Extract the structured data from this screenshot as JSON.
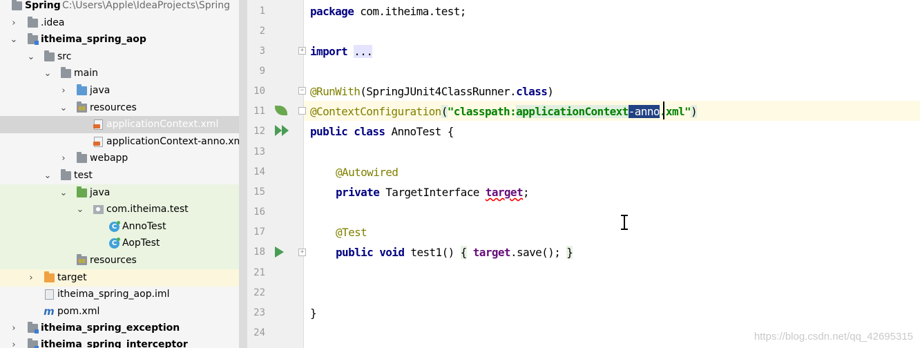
{
  "project": {
    "name": "Spring",
    "path": "C:\\Users\\Apple\\IdeaProjects\\Spring",
    "rows": [
      {
        "label": ".idea"
      },
      {
        "label": "itheima_spring_aop"
      },
      {
        "label": "src"
      },
      {
        "label": "main"
      },
      {
        "label": "java"
      },
      {
        "label": "resources"
      },
      {
        "label": "applicationContext.xml"
      },
      {
        "label": "applicationContext-anno.xml"
      },
      {
        "label": "webapp"
      },
      {
        "label": "test"
      },
      {
        "label": "java"
      },
      {
        "label": "com.itheima.test"
      },
      {
        "label": "AnnoTest"
      },
      {
        "label": "AopTest"
      },
      {
        "label": "resources"
      },
      {
        "label": "target"
      },
      {
        "label": "itheima_spring_aop.iml"
      },
      {
        "label": "pom.xml"
      },
      {
        "label": "itheima_spring_exception"
      },
      {
        "label": "itheima_spring_interceptor"
      }
    ]
  },
  "editor": {
    "line_numbers": [
      "1",
      "2",
      "3",
      "9",
      "10",
      "11",
      "12",
      "13",
      "14",
      "15",
      "16",
      "17",
      "18",
      "21",
      "22",
      "23",
      "24"
    ],
    "code": {
      "l1_kw": "package",
      "l1_rest": " com.itheima.test;",
      "l3_kw": "import",
      "l3_fold": "...",
      "l10_ann": "@RunWith",
      "l10_rest": "(SpringJUnit4ClassRunner.",
      "l10_kw": "class",
      "l10_close": ")",
      "l11_ann": "@ContextConfiguration",
      "l11_open": "(",
      "l11_str1": "\"classpath:",
      "l11_str2": "applicationContext",
      "l11_sel": "-anno",
      "l11_str3": ".xml\"",
      "l11_close": ")",
      "l12_kw": "public class",
      "l12_rest": " AnnoTest {",
      "l14_ann": "@Autowired",
      "l15_kw": "private",
      "l15_type": " TargetInterface ",
      "l15_field": "target",
      "l15_semi": ";",
      "l17_ann": "@Test",
      "l18_kw": "public void",
      "l18_name": " test1() ",
      "l18_open": "{",
      "l18_field": "target",
      "l18_call": ".save(); ",
      "l18_close": "}",
      "l23_brace": "}"
    }
  },
  "watermark": "https://blog.csdn.net/qq_42695315"
}
